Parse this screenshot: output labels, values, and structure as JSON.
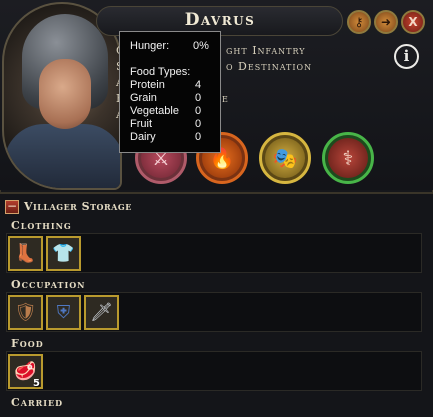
{
  "character": {
    "name": "Davrus",
    "stats": {
      "line1_prefix": "C",
      "line1_visible": "ght Infantry",
      "line2_prefix": "S",
      "line2_visible": "o Destination",
      "line3_prefix": "A",
      "line4_prefix": "F",
      "line4_visible": "e",
      "line5_prefix": "A"
    }
  },
  "controls": {
    "close_label": "X",
    "info_label": "i"
  },
  "tooltip": {
    "hunger_label": "Hunger:",
    "hunger_value": "0%",
    "food_types_label": "Food Types:",
    "rows": [
      {
        "label": "Protein",
        "value": "4"
      },
      {
        "label": "Grain",
        "value": "0"
      },
      {
        "label": "Vegetable",
        "value": "0"
      },
      {
        "label": "Fruit",
        "value": "0"
      },
      {
        "label": "Dairy",
        "value": "0"
      }
    ]
  },
  "storage": {
    "title": "Villager Storage",
    "collapse_label": "−",
    "categories": {
      "clothing": {
        "label": "Clothing"
      },
      "occupation": {
        "label": "Occupation"
      },
      "food": {
        "label": "Food"
      },
      "carried": {
        "label": "Carried"
      }
    },
    "food_item": {
      "quantity": "5"
    }
  }
}
